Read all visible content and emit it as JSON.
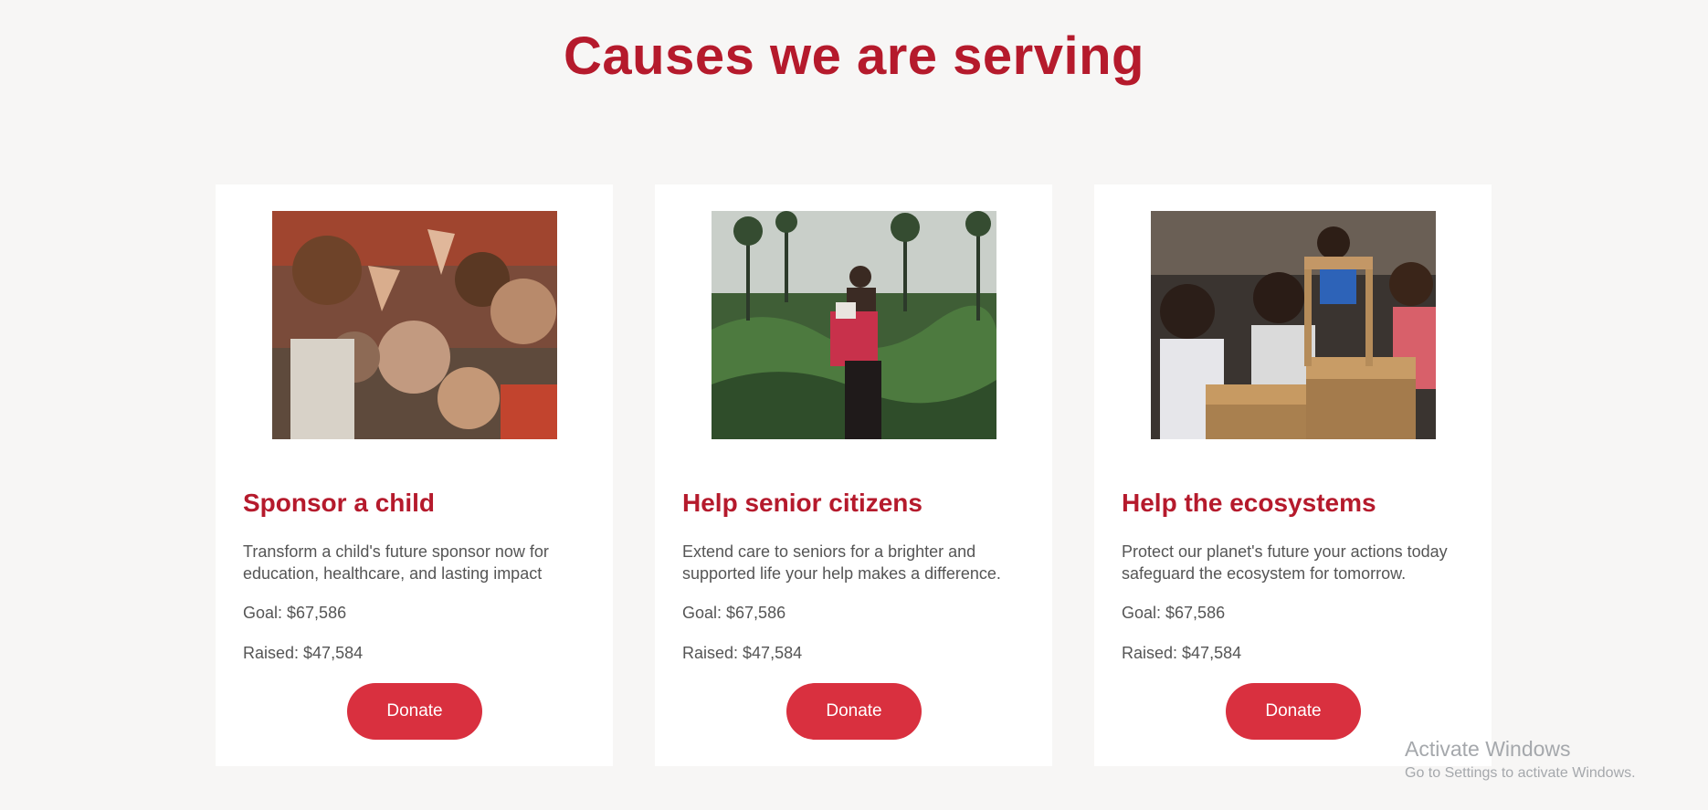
{
  "page": {
    "title": "Causes we are serving"
  },
  "colors": {
    "heading": "#b51a2c",
    "button": "#d9303f",
    "card_background": "#ffffff",
    "page_background": "#f7f6f5",
    "body_text": "#555555"
  },
  "causes": [
    {
      "image": "children-smiling-photo",
      "title": "Sponsor a child",
      "description": "Transform a child's future sponsor now for education, healthcare, and lasting impact",
      "goal": "Goal: $67,586",
      "raised": "Raised: $47,584",
      "button_label": "Donate"
    },
    {
      "image": "woman-carrying-baby-in-forest-photo",
      "title": "Help senior citizens",
      "description": "Extend care to seniors for a brighter and supported life your help makes a difference.",
      "goal": "Goal: $67,586",
      "raised": "Raised: $47,584",
      "button_label": "Donate"
    },
    {
      "image": "children-at-school-desks-photo",
      "title": "Help the ecosystems",
      "description": "Protect our planet's future your actions today safeguard the ecosystem for tomorrow.",
      "goal": "Goal: $67,586",
      "raised": "Raised: $47,584",
      "button_label": "Donate"
    }
  ],
  "watermark": {
    "title": "Activate Windows",
    "subtitle": "Go to Settings to activate Windows."
  }
}
